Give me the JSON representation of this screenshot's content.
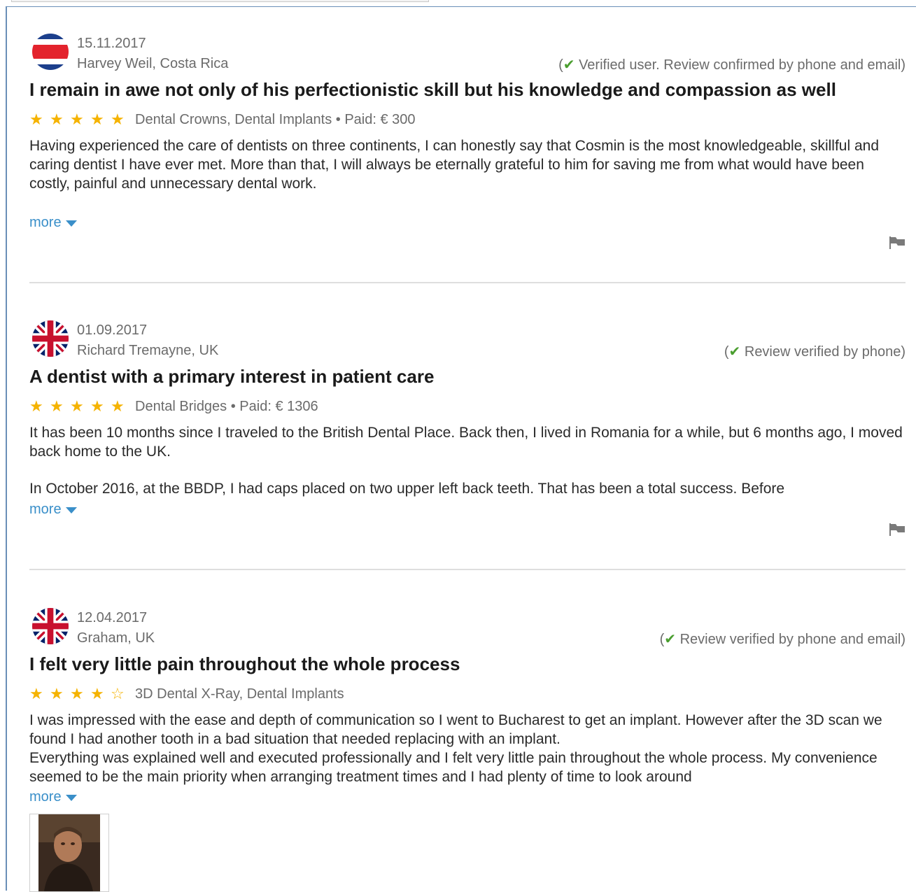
{
  "reviews": [
    {
      "flag": "costa-rica-flag",
      "date": "15.11.2017",
      "author": "Harvey Weil, Costa Rica",
      "verified_prefix": "(",
      "verified_check": "✔",
      "verified_text": " Verified user. Review confirmed by phone and email)",
      "title": "I remain in awe not only of his perfectionistic skill but his knowledge and compassion as well",
      "rating": 5,
      "meta": "Dental Crowns, Dental Implants • Paid: € 300",
      "paragraphs": [
        "Having experienced the care of dentists on three continents, I can honestly say that Cosmin is the most knowledgeable, skillful and caring dentist I have ever met. More than that, I will always be eternally grateful to him for saving me from what would have been costly, painful and unnecessary dental work."
      ],
      "more_label": "more"
    },
    {
      "flag": "uk-flag",
      "date": "01.09.2017",
      "author": "Richard Tremayne, UK",
      "verified_prefix": "(",
      "verified_check": "✔",
      "verified_text": " Review verified by phone)",
      "title": "A dentist with a primary interest in patient care",
      "rating": 5,
      "meta": "Dental Bridges • Paid: € 1306",
      "paragraphs": [
        "It has been 10 months since I traveled to the British Dental Place. Back then, I lived in Romania for a while, but 6 months ago, I moved back home to the UK.",
        "In October 2016, at the BBDP, I had caps placed on two upper left back teeth. That has been a total success. Before"
      ],
      "more_label": "more"
    },
    {
      "flag": "uk-flag",
      "date": "12.04.2017",
      "author": "Graham, UK",
      "verified_prefix": "(",
      "verified_check": "✔",
      "verified_text": " Review verified by phone and email)",
      "title": "I felt very little pain throughout the whole process",
      "rating": 4,
      "meta": "3D Dental X-Ray, Dental Implants",
      "paragraphs": [
        "I was impressed with the ease and depth of communication so I went to Bucharest to get an implant. However after the 3D scan we found I had another tooth in a bad situation that needed replacing with an implant.",
        "Everything was explained well and executed professionally and I felt very little pain throughout the whole process. My convenience seemed to be the main priority when arranging treatment times and I had plenty of time to look around"
      ],
      "more_label": "more"
    }
  ],
  "colors": {
    "star": "#f5b301",
    "link": "#3a8fc9",
    "check": "#4a9e2f",
    "muted_text": "#6b6b6b"
  }
}
